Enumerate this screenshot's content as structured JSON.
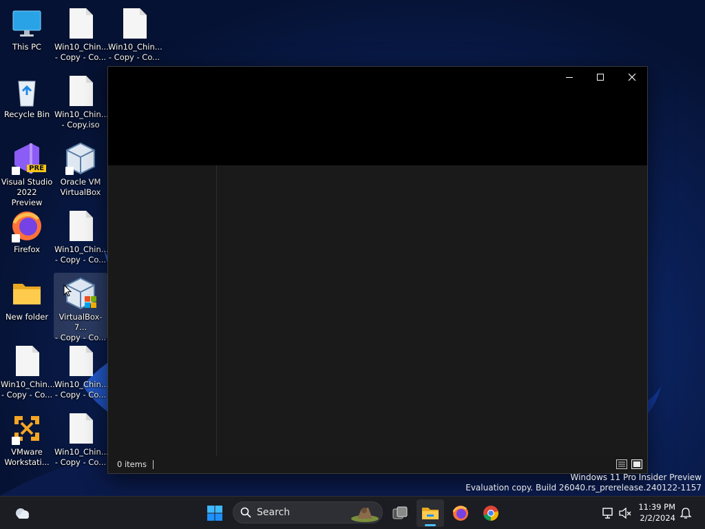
{
  "desktop": {
    "icons": [
      {
        "label": "This PC",
        "icon": "monitor-icon"
      },
      {
        "label": "Win10_Chin...\n- Copy - Co...",
        "icon": "file-icon"
      },
      {
        "label": "Win10_Chin...\n- Copy - Co...",
        "icon": "file-icon"
      },
      {
        "label": "Recycle Bin",
        "icon": "recycle-bin-icon"
      },
      {
        "label": "Win10_Chin...\n- Copy.iso",
        "icon": "file-icon"
      },
      {
        "label": "Visual Studio\n2022 Preview",
        "icon": "visual-studio-icon",
        "badge": "PRE"
      },
      {
        "label": "Oracle VM\nVirtualBox",
        "icon": "virtualbox-icon"
      },
      {
        "label": "Firefox",
        "icon": "firefox-icon"
      },
      {
        "label": "Win10_Chin...\n- Copy - Co...",
        "icon": "file-icon"
      },
      {
        "label": "New folder",
        "icon": "folder-icon"
      },
      {
        "label": "VirtualBox-7...\n- Copy - Co...",
        "icon": "virtualbox-installer-icon"
      },
      {
        "label": "Win10_Chin...\n- Copy - Co...",
        "icon": "file-icon"
      },
      {
        "label": "Win10_Chin...\n- Copy - Co...",
        "icon": "file-icon"
      },
      {
        "label": "VMware\nWorkstati...",
        "icon": "vmware-icon"
      },
      {
        "label": "Win10_Chin...\n- Copy - Co...",
        "icon": "file-icon"
      }
    ]
  },
  "explorer": {
    "status_count": "0 items",
    "controls": [
      "minimize-icon",
      "maximize-icon",
      "close-icon"
    ],
    "view_buttons": [
      "details-view-icon",
      "large-icons-view-icon"
    ]
  },
  "watermark": {
    "line1": "Windows 11 Pro Insider Preview",
    "line2": "Evaluation copy. Build 26040.rs_prerelease.240122-1157"
  },
  "taskbar": {
    "search_label": "Search",
    "apps": [
      "start-icon",
      "task-view-icon",
      "file-explorer-icon",
      "firefox-icon",
      "chrome-icon"
    ],
    "time": "11:39 PM",
    "date": "2/2/2024"
  },
  "colors": {
    "accent": "#4cc2ff",
    "taskbar": "#1b1d22",
    "window": "#191919",
    "titlebar": "#000000"
  }
}
